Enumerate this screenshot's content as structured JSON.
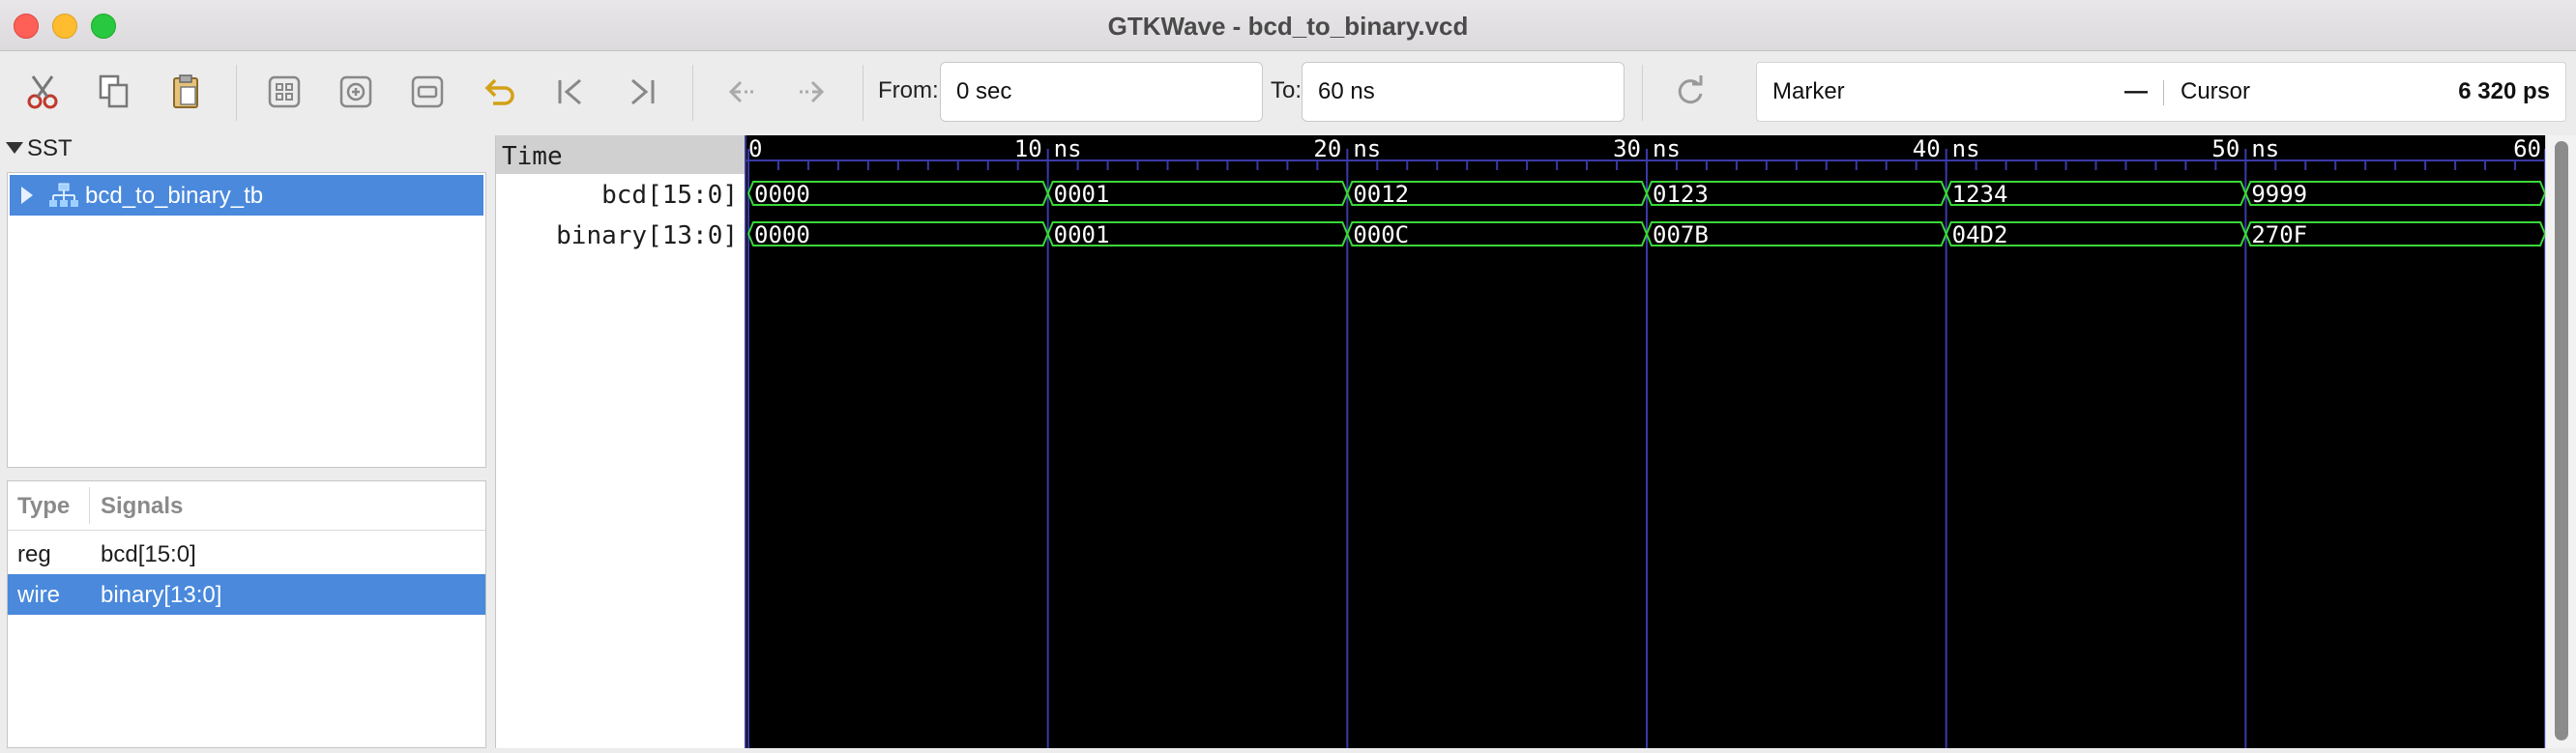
{
  "window": {
    "title": "GTKWave - bcd_to_binary.vcd"
  },
  "toolbar": {
    "icons": [
      "cut-icon",
      "copy-icon",
      "paste-icon",
      "zoom-fit-icon",
      "zoom-in-icon",
      "zoom-out-icon",
      "undo-zoom-icon",
      "jump-start-icon",
      "jump-end-icon",
      "prev-edge-icon",
      "next-edge-icon",
      "reload-icon"
    ],
    "from_label": "From:",
    "from_value": "0 sec",
    "to_label": "To:",
    "to_value": "60 ns",
    "marker_label": "Marker",
    "marker_value": "—",
    "cursor_label": "Cursor",
    "cursor_value": "6 320 ps"
  },
  "sst": {
    "header": "SST",
    "tree": [
      {
        "label": "bcd_to_binary_tb",
        "selected": true
      }
    ]
  },
  "signal_list": {
    "col_type": "Type",
    "col_signals": "Signals",
    "rows": [
      {
        "type": "reg",
        "name": "bcd[15:0]",
        "selected": false
      },
      {
        "type": "wire",
        "name": "binary[13:0]",
        "selected": true
      }
    ]
  },
  "waves": {
    "time_header": "Time",
    "time_range_ns": [
      0,
      60
    ],
    "major_ticks": [
      {
        "t": 0,
        "label": "0"
      },
      {
        "t": 10,
        "label": "10 ns"
      },
      {
        "t": 20,
        "label": "20 ns"
      },
      {
        "t": 30,
        "label": "30 ns"
      },
      {
        "t": 40,
        "label": "40 ns"
      },
      {
        "t": 50,
        "label": "50 ns"
      },
      {
        "t": 60,
        "label": "60"
      }
    ],
    "signals": [
      {
        "name": "bcd[15:0]",
        "values": [
          "0000",
          "0001",
          "0012",
          "0123",
          "1234",
          "9999"
        ]
      },
      {
        "name": "binary[13:0]",
        "values": [
          "0000",
          "0001",
          "000C",
          "007B",
          "04D2",
          "270F"
        ]
      }
    ],
    "segment_ns": 10,
    "colors": {
      "trace": "#39d839",
      "grid": "#3a3aa8",
      "text": "#ffffff",
      "background": "#000000"
    }
  }
}
